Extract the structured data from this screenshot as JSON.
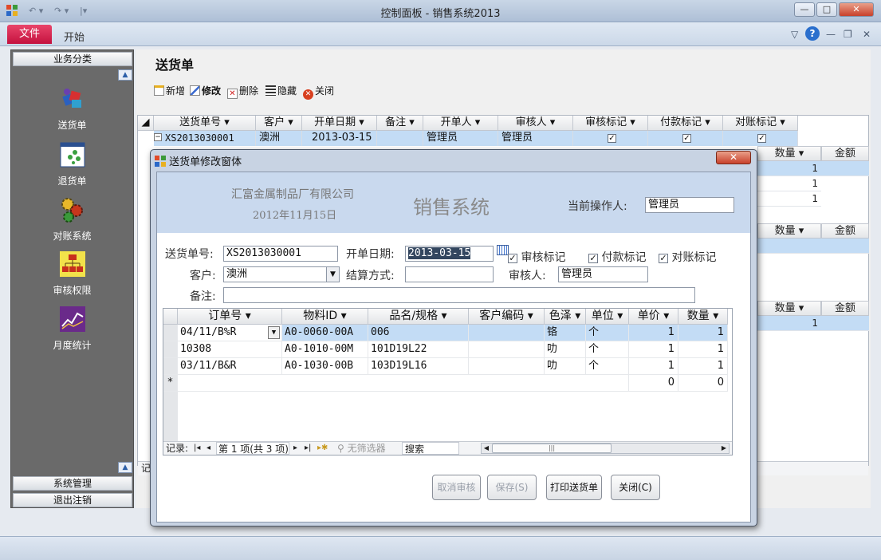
{
  "window": {
    "title": "控制面板 - 销售系统2013",
    "min": "—",
    "max": "□",
    "close": "✕"
  },
  "ribbon": {
    "file_tab": "文件",
    "home_tab": "开始"
  },
  "nav": {
    "header": "业务分类",
    "items": [
      {
        "label": "送货单",
        "icon": "delivery-icon"
      },
      {
        "label": "退货单",
        "icon": "return-icon"
      },
      {
        "label": "对账系统",
        "icon": "gears-icon"
      },
      {
        "label": "审核权限",
        "icon": "org-chart-icon"
      },
      {
        "label": "月度统计",
        "icon": "stock-chart-icon"
      }
    ],
    "footer": [
      "系统管理",
      "退出注销"
    ]
  },
  "page": {
    "title": "送货单"
  },
  "toolbar": {
    "new": "新增",
    "edit": "修改",
    "delete": "删除",
    "hide": "隐藏",
    "close": "关闭"
  },
  "main_grid": {
    "headers": [
      "送货单号",
      "客户",
      "开单日期",
      "备注",
      "开单人",
      "审核人",
      "审核标记",
      "付款标记",
      "对账标记"
    ],
    "row": {
      "id": "XS2013030001",
      "customer": "澳洲",
      "date": "2013-03-15",
      "note": "",
      "creator": "管理员",
      "approver": "管理员",
      "audit": "✓",
      "paid": "✓",
      "checked": "✓"
    },
    "right_headers": [
      "数量",
      "金额"
    ],
    "right_values": [
      "1",
      "1",
      "1",
      "1"
    ],
    "sub_header_partial": "送货单号",
    "status_partial": "记"
  },
  "dialog": {
    "title": "送货单修改窗体",
    "close": "✕",
    "company": "汇富金属制品厂有限公司",
    "date": "2012年11月15日",
    "system": "销售系统",
    "operator_label": "当前操作人:",
    "operator": "管理员",
    "labels": {
      "order_no": "送货单号:",
      "open_date": "开单日期:",
      "customer": "客户:",
      "settle": "结算方式:",
      "approver": "审核人:",
      "note": "备注:"
    },
    "values": {
      "order_no": "XS2013030001",
      "open_date": "2013-03-15",
      "customer": "澳洲",
      "settle": "",
      "approver": "管理员",
      "note": ""
    },
    "checks": {
      "audit": "审核标记",
      "paid": "付款标记",
      "checked": "对账标记",
      "mark": "✓"
    },
    "grid": {
      "headers": [
        "订单号",
        "物料ID",
        "品名/规格",
        "客户编码",
        "色泽",
        "单位",
        "单价",
        "数量"
      ],
      "rows": [
        {
          "order": "04/11/B%R",
          "mat": "A0-0060-00A",
          "name": "006",
          "code": "",
          "color": "铬",
          "unit": "个",
          "price": "1",
          "qty": "1"
        },
        {
          "order": "10308",
          "mat": "A0-1010-00M",
          "name": "101D19L22",
          "code": "",
          "color": "叻",
          "unit": "个",
          "price": "1",
          "qty": "1"
        },
        {
          "order": "03/11/B&R",
          "mat": "A0-1030-00B",
          "name": "103D19L16",
          "code": "",
          "color": "叻",
          "unit": "个",
          "price": "1",
          "qty": "1"
        }
      ],
      "new_row": {
        "marker": "*",
        "price": "0",
        "qty": "0"
      },
      "nav": {
        "record_label": "记录:",
        "position": "第 1 项(共 3 项)",
        "filter": "无筛选器",
        "search": "搜索"
      }
    },
    "buttons": {
      "cancel_audit": "取消审核",
      "save": "保存(S)",
      "print": "打印送货单",
      "close": "关闭(C)"
    }
  }
}
